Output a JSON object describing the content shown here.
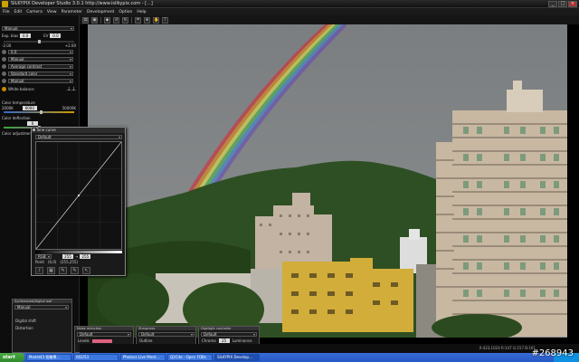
{
  "window": {
    "title": "SILKYPIX Developer Studio 3.0.1 http://www.isilkypix.com - [...]"
  },
  "menu": [
    "File",
    "Edit",
    "Camera",
    "View",
    "Parameter",
    "Development",
    "Option",
    "Help"
  ],
  "toolbar": {
    "icons": [
      "open-icon",
      "save-icon",
      "develop-icon",
      "rotate-left-icon",
      "rotate-right-icon",
      "crop-icon",
      "zoom-icon",
      "hand-icon",
      "pipette-icon"
    ]
  },
  "left_panel": {
    "preset": "Manual",
    "exposure_label": "Exp. bias",
    "exposure_value": "0.0",
    "exposure_ev": "0.0",
    "exposure_range_min": "-2.00",
    "exposure_range_max": "+2.00",
    "white_balance": "0.0",
    "tone_mode": "Manual",
    "contrast": "Average contrast",
    "color_mode": "Standard color",
    "sharpness": "Manual",
    "wb_button": "White balance",
    "color_temp_label": "Color temperature",
    "color_temp_min": "2000K",
    "color_temp_value": "6000",
    "color_temp_max": "50000K",
    "color_deflection_label": "Color deflection",
    "color_deflection_value": "0",
    "color_adjust_label": "Color adjustment"
  },
  "tone_curve": {
    "title": "Tone curve",
    "preset": "Default",
    "channel": "RGB",
    "input_value": "255",
    "output_value": "255",
    "point_label": "Point",
    "point_coords": "(0,0)",
    "point_coords2": "(255,255)"
  },
  "bottom_panels": [
    {
      "title": "Synthesized/Digital leaf",
      "preset": "Manual",
      "opt1": "Digital shift",
      "opt2": "Distortion",
      "value": "0"
    },
    {
      "title": "Noise reduction",
      "preset": "Default",
      "opt1": "Levels",
      "value": ""
    },
    {
      "title": "Sharpness",
      "preset": "Default",
      "opt1": "Outline",
      "value": ""
    },
    {
      "title": "Highlight controller",
      "preset": "Default",
      "opt1": "Chroma",
      "value": "25",
      "opt2": "Luminance"
    }
  ],
  "status": {
    "coords": "X:423,1024  R:147 G:157 B:161"
  },
  "taskbar": {
    "start": "start",
    "items": [
      "Model43 相機專...",
      "002/53",
      "Photoss Live Meet...",
      "Q2Cite - Open FOBs",
      "SILKYPIX Develop..."
    ],
    "clock": ""
  },
  "watermark": "#268943"
}
